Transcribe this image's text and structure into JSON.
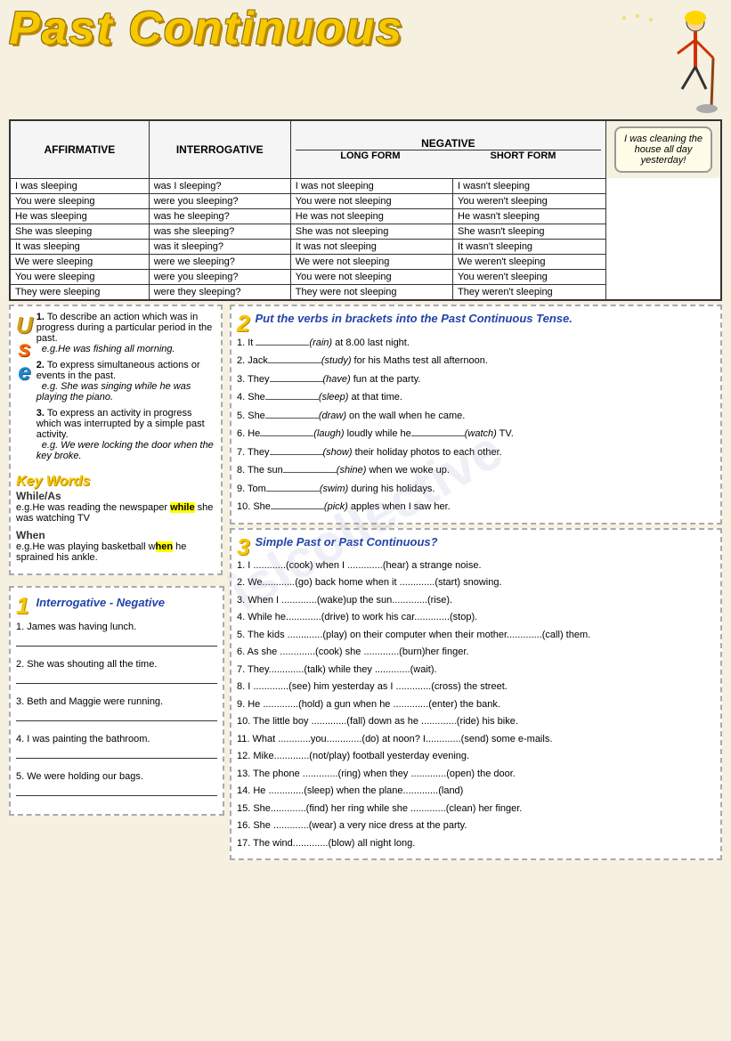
{
  "title": "Past Continuous",
  "table": {
    "headers": {
      "affirmative": "Affirmative",
      "interrogative": "Interrogative",
      "negative": "Negative",
      "long_form": "Long Form",
      "short_form": "Short Form"
    },
    "rows": [
      {
        "aff": "I was sleeping",
        "int": "was I sleeping?",
        "neg_long": "I was not sleeping",
        "neg_short": "I wasn't sleeping"
      },
      {
        "aff": "You were sleeping",
        "int": "were you sleeping?",
        "neg_long": "You were not sleeping",
        "neg_short": "You weren't sleeping"
      },
      {
        "aff": "He was sleeping",
        "int": "was he sleeping?",
        "neg_long": "He was not sleeping",
        "neg_short": "He wasn't sleeping"
      },
      {
        "aff": "She was sleeping",
        "int": "was she sleeping?",
        "neg_long": "She  was not sleeping",
        "neg_short": "She wasn't sleeping"
      },
      {
        "aff": "It was sleeping",
        "int": "was it sleeping?",
        "neg_long": "It  was not sleeping",
        "neg_short": "It wasn't sleeping"
      },
      {
        "aff": "We were sleeping",
        "int": "were we sleeping?",
        "neg_long": "We were not sleeping",
        "neg_short": "We weren't sleeping"
      },
      {
        "aff": "You  were sleeping",
        "int": "were you sleeping?",
        "neg_long": "You were not sleeping",
        "neg_short": "You  weren't sleeping"
      },
      {
        "aff": "They were sleeping",
        "int": "were they sleeping?",
        "neg_long": "They were not sleeping",
        "neg_short": "They weren't sleeping"
      }
    ],
    "speech_bubble": "I was cleaning the house all day yesterday!"
  },
  "uses": {
    "title": "Uses",
    "items": [
      {
        "num": "1.",
        "text": "To describe an action which was in progress during a particular period in the past.",
        "example": "e.g.He was fishing all morning."
      },
      {
        "num": "2.",
        "text": "To express simultaneous actions or events in the past.",
        "example": "e.g. She was singing while he was playing the piano."
      },
      {
        "num": "3.",
        "text": "To express an activity in progress which was interrupted by a simple past activity.",
        "example": "e.g. We were locking the door when the key broke."
      }
    ]
  },
  "key_words": {
    "title": "Key Words",
    "items": [
      {
        "word": "While/As",
        "example": "e.g.He was reading the newspaper ",
        "highlight": "while",
        "after": " she was watching TV"
      },
      {
        "word": "When",
        "example": "e.g.He was playing basketball w",
        "highlight": "hen",
        "after": " he sprained his ankle."
      }
    ]
  },
  "section1": {
    "title": "Interrogative - Negative",
    "num": "1",
    "items": [
      "1. James was having lunch.",
      "2. She was shouting all the time.",
      "3. Beth and Maggie were running.",
      "4. I was painting the bathroom.",
      "5. We were holding our bags."
    ]
  },
  "section2": {
    "num": "2",
    "title": "Put the verbs in brackets into the Past Continuous Tense.",
    "items": [
      {
        "text": "1. It ",
        "blank": "",
        "hint": "(rain)",
        "after": " at 8.00 last night."
      },
      {
        "text": "2. Jack",
        "blank": "",
        "hint": "(study)",
        "after": " for his Maths test all afternoon."
      },
      {
        "text": "3. They",
        "blank": "",
        "hint": "(have)",
        "after": " fun at the party."
      },
      {
        "text": "4. She",
        "blank": "",
        "hint": "(sleep)",
        "after": " at that time."
      },
      {
        "text": "5. She",
        "blank": "",
        "hint": "(draw)",
        "after": " on the wall when he came."
      },
      {
        "text": "6. He",
        "blank": "",
        "hint": "(laugh)",
        "after": " loudly while he",
        "blank2": "",
        "hint2": "(watch)",
        "after2": " TV."
      },
      {
        "text": "7. They",
        "blank": "",
        "hint": "(show)",
        "after": " their holiday photos to each other."
      },
      {
        "text": "8. The sun",
        "blank": "",
        "hint": "(shine)",
        "after": " when we woke up."
      },
      {
        "text": "9. Tom",
        "blank": "",
        "hint": "(swim)",
        "after": " during his holidays."
      },
      {
        "text": "10. She",
        "blank": "",
        "hint": "(pick)",
        "after": " apples when I saw her."
      }
    ]
  },
  "section3": {
    "num": "3",
    "title": "Simple Past or Past Continuous?",
    "items": [
      "1. I ............(cook) when I .............(hear) a strange noise.",
      "2. We............(go) back home when it .............(start) snowing.",
      "3. When I .............(wake)up the sun.............(rise).",
      "4. While he.............(drive) to work his car.............(stop).",
      "5. The kids .............(play) on their computer when their mother.............(call) them.",
      "6. As she .............(cook) she .............(burn)her finger.",
      "7. They.............(talk) while they .............(wait).",
      "8. I .............(see) him yesterday as I .............(cross) the street.",
      "9. He .............(hold) a gun when he .............(enter) the bank.",
      "10. The little boy .............(fall) down as he .............(ride) his bike.",
      "11. What ............you.............(do) at noon? I.............(send) some e-mails.",
      "12. Mike.............(not/play) football yesterday evening.",
      "13. The phone .............(ring) when they .............(open) the door.",
      "14. He .............(sleep) when the plane.............(land)",
      "15. She.............(find) her ring while she .............(clean) her finger.",
      "16. She .............(wear) a very nice dress at the party.",
      "17. The wind.............(blow) all night long."
    ]
  }
}
